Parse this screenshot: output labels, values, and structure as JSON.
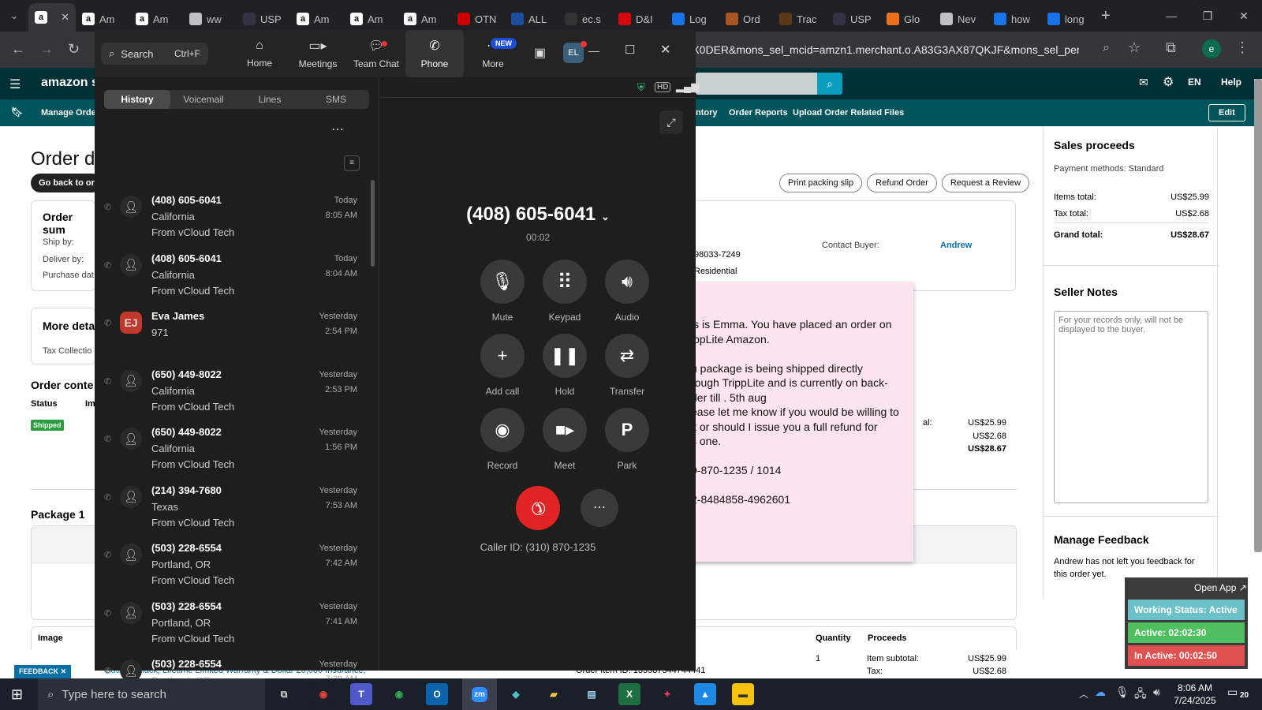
{
  "browser": {
    "tabs": [
      {
        "label": "",
        "icon": "amazon-icon",
        "color": "#ffffff"
      },
      {
        "label": "Am",
        "icon": "amazon-icon",
        "color": "#ffffff"
      },
      {
        "label": "Am",
        "icon": "amazon-icon",
        "color": "#ffffff"
      },
      {
        "label": "ww",
        "icon": "globe-icon",
        "color": "#bdc1c6"
      },
      {
        "label": "USP",
        "icon": "usps-icon",
        "color": "#334"
      },
      {
        "label": "Am",
        "icon": "amazon-icon",
        "color": "#ffffff"
      },
      {
        "label": "Am",
        "icon": "amazon-icon",
        "color": "#ffffff"
      },
      {
        "label": "Am",
        "icon": "amazon-icon",
        "color": "#ffffff"
      },
      {
        "label": "OTN",
        "icon": "otn-icon",
        "color": "#c00"
      },
      {
        "label": "ALL",
        "icon": "17track-icon",
        "color": "#1a4fa3"
      },
      {
        "label": "ec.s",
        "icon": "ec-icon",
        "color": "#333"
      },
      {
        "label": "D&I",
        "icon": "dhl-icon",
        "color": "#d40511"
      },
      {
        "label": "Log",
        "icon": "google-icon",
        "color": "#1a73e8"
      },
      {
        "label": "Ord",
        "icon": "order-icon",
        "color": "#a52"
      },
      {
        "label": "Trac",
        "icon": "ups-icon",
        "color": "#5a3a1a"
      },
      {
        "label": "USP",
        "icon": "usps-icon",
        "color": "#334"
      },
      {
        "label": "Glo",
        "icon": "glo-icon",
        "color": "#e8711a"
      },
      {
        "label": "Nev",
        "icon": "chrome-icon",
        "color": "#bdc1c6"
      },
      {
        "label": "how",
        "icon": "google-icon",
        "color": "#1a73e8"
      },
      {
        "label": "long",
        "icon": "google-icon",
        "color": "#1a73e8"
      }
    ],
    "new_tab": "+",
    "url": "KX0DER&mons_sel_mcid=amzn1.merchant.o.A83G3AX87QKJF&mons_sel_persi..."
  },
  "amazon": {
    "logo": "amazon sel",
    "lang": "EN",
    "help": "Help",
    "nav": {
      "manage_orders": "Manage Order",
      "inventory": "ntory",
      "order_reports": "Order Reports",
      "upload": "Upload Order Related Files",
      "edit": "Edit"
    },
    "page_title": "Order de",
    "back_button": "Go back to ord",
    "actions": {
      "print": "Print packing slip",
      "refund": "Refund Order",
      "review": "Request a Review"
    },
    "order_summary": {
      "title": "Order sum",
      "ship_by": "Ship by:",
      "deliver_by": "Deliver by:",
      "purchase_date": "Purchase dat"
    },
    "contact_buyer": {
      "label": "Contact Buyer:",
      "name": "Andrew"
    },
    "address_zip": "98033-7249",
    "address_type": "Residential",
    "more_details": {
      "title": "More deta",
      "tax": "Tax Collectio"
    },
    "order_contents": {
      "title": "Order conte",
      "status_hdr": "Status",
      "img_hdr": "Im",
      "status": "Shipped",
      "subtotal_label": "al:",
      "subtotal": "US$25.99",
      "tax": "US$2.68",
      "total": "US$28.67"
    },
    "package": {
      "title": "Package 1"
    },
    "bottom_table": {
      "image": "Image",
      "quantity": "Quantity",
      "proceeds": "Proceeds",
      "qty": "1",
      "item_subtotal": "Item subtotal:",
      "item_subtotal_val": "US$25.99",
      "tax_label": "Tax:",
      "tax_val": "US$2.68",
      "product": "Outlets, Black, Lifetime Limited Warranty & Dollar 20,000 Insurance,",
      "order_item_id": "Order Item ID: 135587344744441"
    },
    "sales": {
      "title": "Sales proceeds",
      "payment": "Payment methods: Standard",
      "items_label": "Items total:",
      "items_val": "US$25.99",
      "tax_label": "Tax total:",
      "tax_val": "US$2.68",
      "grand_label": "Grand total:",
      "grand_val": "US$28.67"
    },
    "seller_notes": {
      "title": "Seller Notes",
      "placeholder": "For your records only, will not be displayed to the buyer."
    },
    "feedback": {
      "title": "Manage Feedback",
      "text": "Andrew has not left you feedback for this order yet.",
      "tag": "FEEDBACK"
    }
  },
  "note": {
    "lines": [
      "is is Emma. You have placed an order on",
      "ippLite Amazon.",
      "",
      "u package is being shipped directly",
      "rough TrippLite and is currently on back-",
      "der till . 5th aug",
      "ease let me know if you would be willing to",
      "it or should I issue you a full refund for",
      "s one.",
      "",
      "0-870-1235 / 1014",
      "",
      "2-8484858-4962601"
    ]
  },
  "zoom": {
    "search": {
      "label": "Search",
      "shortcut": "Ctrl+F"
    },
    "nav": [
      {
        "label": "Home",
        "icon": "home-icon"
      },
      {
        "label": "Meetings",
        "icon": "video-icon"
      },
      {
        "label": "Team Chat",
        "icon": "chat-icon"
      },
      {
        "label": "Phone",
        "icon": "phone-icon"
      },
      {
        "label": "More",
        "icon": "more-icon"
      }
    ],
    "new_badge": "NEW",
    "avatar": "EL",
    "tabs": [
      "History",
      "Voicemail",
      "Lines",
      "SMS"
    ],
    "history": [
      {
        "name": "(408) 605-6041",
        "loc": "California",
        "src": "From vCloud Tech",
        "day": "Today",
        "time": "8:05 AM"
      },
      {
        "name": "(408) 605-6041",
        "loc": "California",
        "src": "From vCloud Tech",
        "day": "Today",
        "time": "8:04 AM"
      },
      {
        "name": "Eva James",
        "loc": "971",
        "src": "",
        "day": "Yesterday",
        "time": "2:54 PM",
        "initials": "EJ"
      },
      {
        "name": "(650) 449-8022",
        "loc": "California",
        "src": "From vCloud Tech",
        "day": "Yesterday",
        "time": "2:53 PM"
      },
      {
        "name": "(650) 449-8022",
        "loc": "California",
        "src": "From vCloud Tech",
        "day": "Yesterday",
        "time": "1:56 PM"
      },
      {
        "name": "(214) 394-7680",
        "loc": "Texas",
        "src": "From vCloud Tech",
        "day": "Yesterday",
        "time": "7:53 AM"
      },
      {
        "name": "(503) 228-6554",
        "loc": "Portland, OR",
        "src": "From vCloud Tech",
        "day": "Yesterday",
        "time": "7:42 AM"
      },
      {
        "name": "(503) 228-6554",
        "loc": "Portland, OR",
        "src": "From vCloud Tech",
        "day": "Yesterday",
        "time": "7:41 AM"
      },
      {
        "name": "(503) 228-6554",
        "loc": "Portland, OR",
        "src": "From vCloud Tech",
        "day": "Yesterday",
        "time": "7:39 AM"
      }
    ],
    "call": {
      "number": "(408) 605-6041",
      "timer": "00:02",
      "caller_id": "Caller ID: (310) 870-1235"
    },
    "controls": [
      {
        "label": "Mute",
        "icon": "microphone-icon"
      },
      {
        "label": "Keypad",
        "icon": "keypad-icon"
      },
      {
        "label": "Audio",
        "icon": "speaker-icon"
      },
      {
        "label": "Add call",
        "icon": "plus-icon"
      },
      {
        "label": "Hold",
        "icon": "pause-icon"
      },
      {
        "label": "Transfer",
        "icon": "transfer-icon"
      },
      {
        "label": "Record",
        "icon": "record-icon"
      },
      {
        "label": "Meet",
        "icon": "video-icon"
      },
      {
        "label": "Park",
        "icon": "park-icon"
      }
    ]
  },
  "status_widget": {
    "open_app": "Open App ↗",
    "working": "Working Status: Active",
    "active": "Active: 02:02:30",
    "inactive": "In Active: 00:02:50"
  },
  "taskbar": {
    "search_placeholder": "Type here to search",
    "time": "8:06 AM",
    "date": "7/24/2025",
    "notif": "20"
  }
}
